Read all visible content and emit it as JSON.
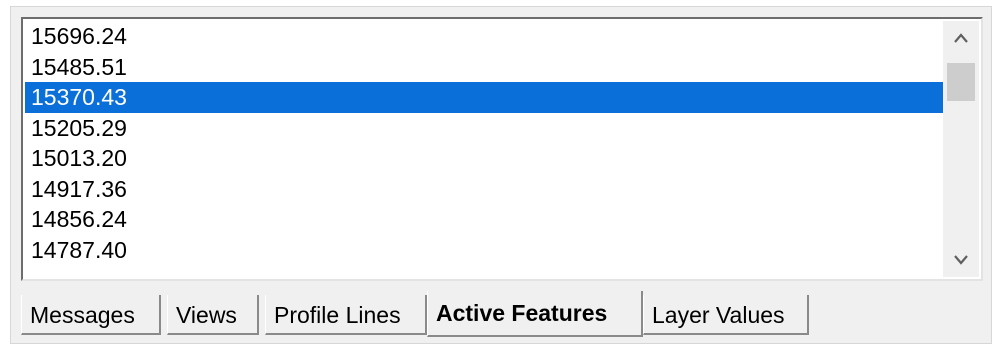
{
  "list": {
    "items": [
      {
        "label": "15696.24",
        "selected": false
      },
      {
        "label": "15485.51",
        "selected": false
      },
      {
        "label": "15370.43",
        "selected": true
      },
      {
        "label": "15205.29",
        "selected": false
      },
      {
        "label": "15013.20",
        "selected": false
      },
      {
        "label": "14917.36",
        "selected": false
      },
      {
        "label": "14856.24",
        "selected": false
      },
      {
        "label": "14787.40",
        "selected": false
      }
    ]
  },
  "tabs": [
    {
      "label": "Messages",
      "active": false
    },
    {
      "label": "Views",
      "active": false
    },
    {
      "label": "Profile Lines",
      "active": false
    },
    {
      "label": "Active Features",
      "active": true
    },
    {
      "label": "Layer Values",
      "active": false
    }
  ],
  "colors": {
    "selection": "#0a6fd8",
    "panel_background": "#f0f0f0"
  },
  "icons": {
    "scroll_up": "chevron-up-icon",
    "scroll_down": "chevron-down-icon"
  }
}
